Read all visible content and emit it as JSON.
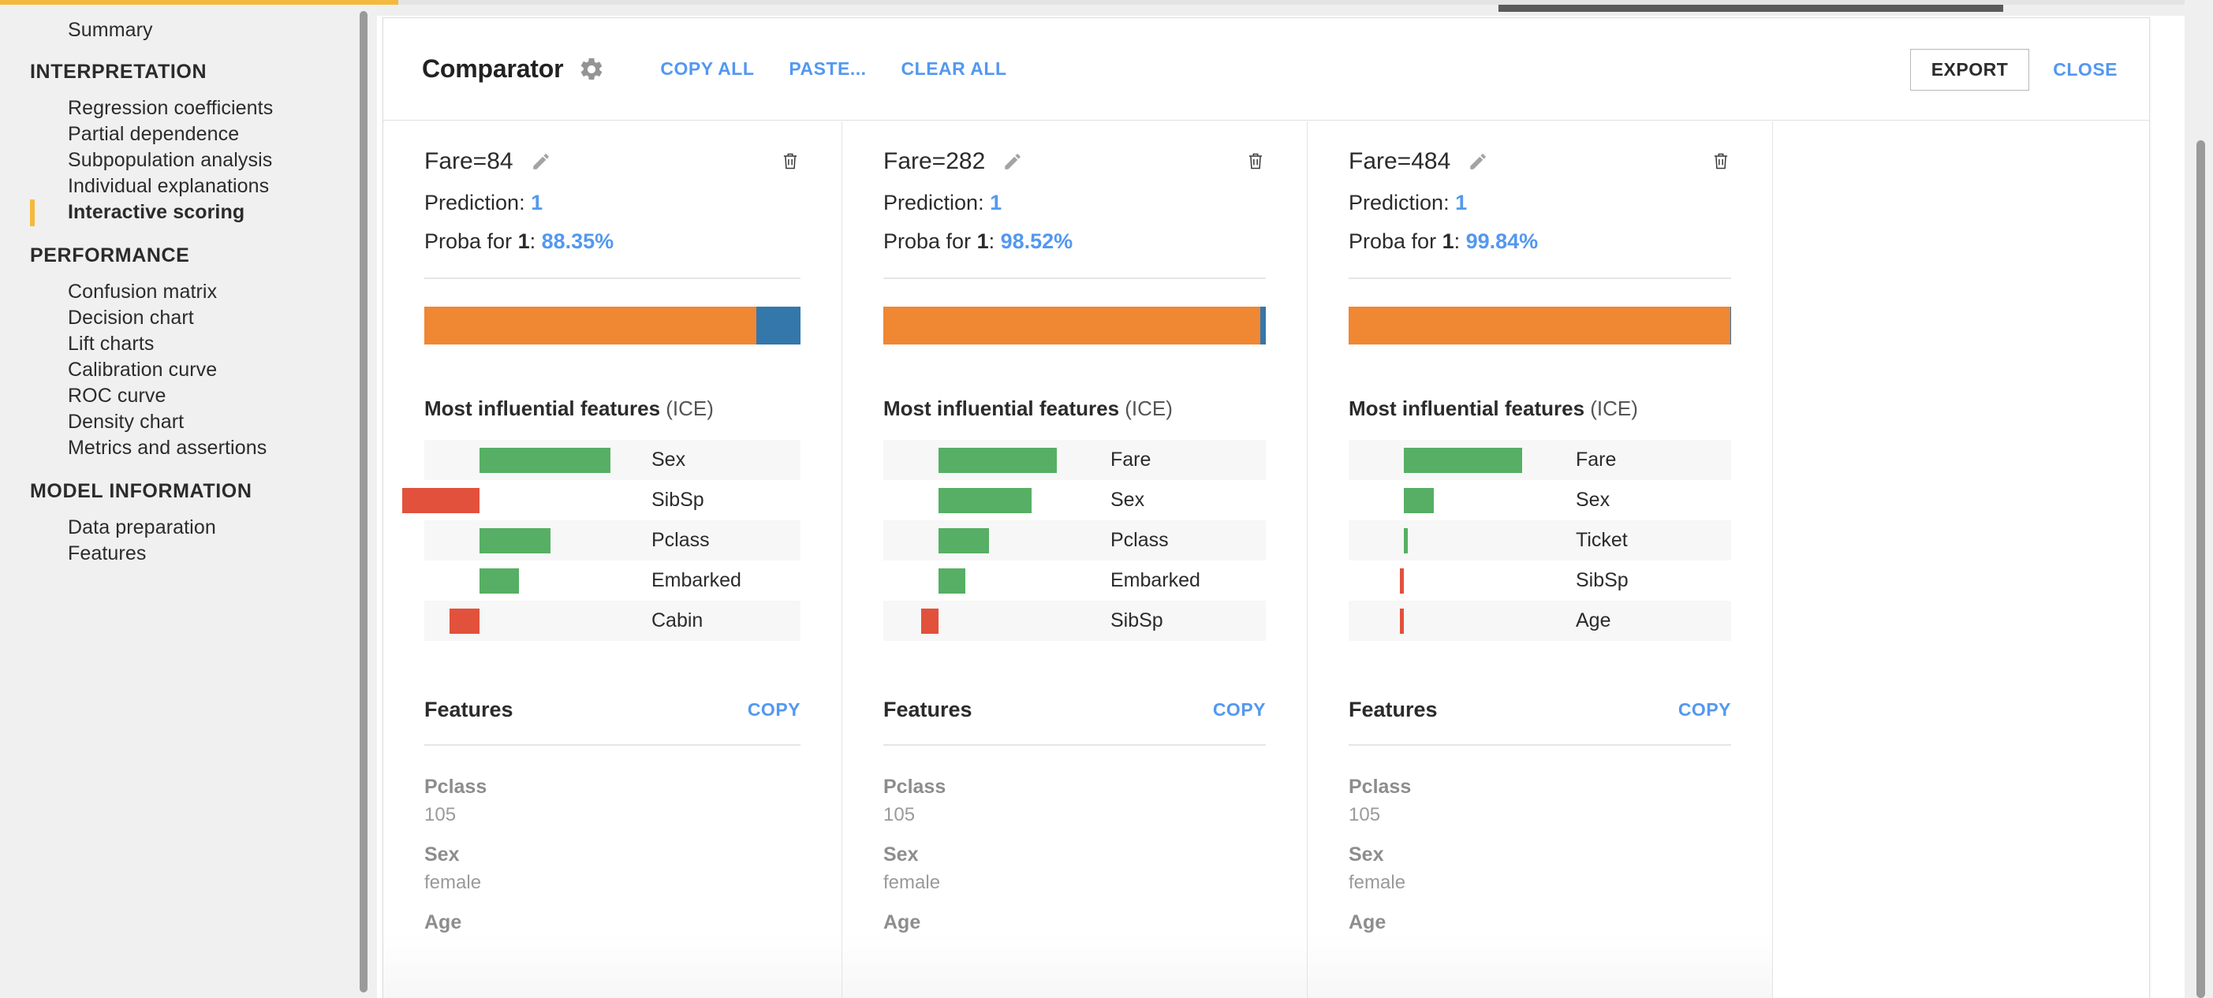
{
  "accent": {
    "link": "#5398f0",
    "highlight": "#f4b93e",
    "positive": "#56af64",
    "negative": "#e2513c",
    "orange": "#ef8733",
    "blue": "#3477ab"
  },
  "sidebar": {
    "top_item": {
      "label": "Summary"
    },
    "sections": [
      {
        "heading": "INTERPRETATION",
        "items": [
          {
            "label": "Regression coefficients",
            "active": false
          },
          {
            "label": "Partial dependence",
            "active": false
          },
          {
            "label": "Subpopulation analysis",
            "active": false
          },
          {
            "label": "Individual explanations",
            "active": false
          },
          {
            "label": "Interactive scoring",
            "active": true
          }
        ]
      },
      {
        "heading": "PERFORMANCE",
        "items": [
          {
            "label": "Confusion matrix",
            "active": false
          },
          {
            "label": "Decision chart",
            "active": false
          },
          {
            "label": "Lift charts",
            "active": false
          },
          {
            "label": "Calibration curve",
            "active": false
          },
          {
            "label": "ROC curve",
            "active": false
          },
          {
            "label": "Density chart",
            "active": false
          },
          {
            "label": "Metrics and assertions",
            "active": false
          }
        ]
      },
      {
        "heading": "MODEL INFORMATION",
        "items": [
          {
            "label": "Data preparation",
            "active": false
          },
          {
            "label": "Features",
            "active": false
          }
        ]
      }
    ]
  },
  "header": {
    "title": "Comparator",
    "gear_icon": "gear-icon",
    "links": [
      {
        "label": "COPY ALL",
        "name": "copy-all"
      },
      {
        "label": "PASTE...",
        "name": "paste"
      },
      {
        "label": "CLEAR ALL",
        "name": "clear-all"
      }
    ],
    "export_label": "EXPORT",
    "close_label": "CLOSE"
  },
  "labels": {
    "prediction_prefix": "Prediction: ",
    "proba_prefix": "Proba for ",
    "proba_mid": ": ",
    "ice_title_strong": "Most influential features ",
    "ice_title_light": "(ICE)",
    "features_title": "Features",
    "copy_label": "COPY",
    "edit_icon": "pencil-icon",
    "delete_icon": "trash-icon"
  },
  "columns": [
    {
      "name": "Fare=84",
      "prediction": "1",
      "proba_class": "1",
      "proba_value": "88.35%",
      "proba_pct": 88.35,
      "ice": [
        {
          "feature": "Sex",
          "value": 0.415,
          "sign": "pos"
        },
        {
          "feature": "SibSp",
          "value": -0.245,
          "sign": "neg"
        },
        {
          "feature": "Pclass",
          "value": 0.225,
          "sign": "pos"
        },
        {
          "feature": "Embarked",
          "value": 0.125,
          "sign": "pos"
        },
        {
          "feature": "Cabin",
          "value": -0.095,
          "sign": "neg"
        }
      ],
      "features": [
        {
          "key": "Pclass",
          "value": "105"
        },
        {
          "key": "Sex",
          "value": "female"
        },
        {
          "key": "Age",
          "value": ""
        }
      ]
    },
    {
      "name": "Fare=282",
      "prediction": "1",
      "proba_class": "1",
      "proba_value": "98.52%",
      "proba_pct": 98.52,
      "ice": [
        {
          "feature": "Fare",
          "value": 0.375,
          "sign": "pos"
        },
        {
          "feature": "Sex",
          "value": 0.295,
          "sign": "pos"
        },
        {
          "feature": "Pclass",
          "value": 0.16,
          "sign": "pos"
        },
        {
          "feature": "Embarked",
          "value": 0.085,
          "sign": "pos"
        },
        {
          "feature": "SibSp",
          "value": -0.055,
          "sign": "neg"
        }
      ],
      "features": [
        {
          "key": "Pclass",
          "value": "105"
        },
        {
          "key": "Sex",
          "value": "female"
        },
        {
          "key": "Age",
          "value": ""
        }
      ]
    },
    {
      "name": "Fare=484",
      "prediction": "1",
      "proba_class": "1",
      "proba_value": "99.84%",
      "proba_pct": 99.84,
      "ice": [
        {
          "feature": "Fare",
          "value": 0.375,
          "sign": "pos"
        },
        {
          "feature": "Sex",
          "value": 0.095,
          "sign": "pos"
        },
        {
          "feature": "Ticket",
          "value": 0.012,
          "sign": "pos"
        },
        {
          "feature": "SibSp",
          "value": -0.012,
          "sign": "neg"
        },
        {
          "feature": "Age",
          "value": -0.012,
          "sign": "neg"
        }
      ],
      "features": [
        {
          "key": "Pclass",
          "value": "105"
        },
        {
          "key": "Sex",
          "value": "female"
        },
        {
          "key": "Age",
          "value": ""
        }
      ]
    }
  ],
  "chart_data": [
    {
      "type": "bar",
      "title": "Most influential features (ICE) — Fare=84",
      "orientation": "horizontal",
      "categories": [
        "Sex",
        "SibSp",
        "Pclass",
        "Embarked",
        "Cabin"
      ],
      "values": [
        0.415,
        -0.245,
        0.225,
        0.125,
        -0.095
      ],
      "xlabel": "",
      "ylabel": "",
      "xlim": [
        -0.45,
        0.55
      ],
      "grid": false,
      "legend": null
    },
    {
      "type": "bar",
      "title": "Most influential features (ICE) — Fare=282",
      "orientation": "horizontal",
      "categories": [
        "Fare",
        "Sex",
        "Pclass",
        "Embarked",
        "SibSp"
      ],
      "values": [
        0.375,
        0.295,
        0.16,
        0.085,
        -0.055
      ],
      "xlabel": "",
      "ylabel": "",
      "xlim": [
        -0.45,
        0.55
      ],
      "grid": false,
      "legend": null
    },
    {
      "type": "bar",
      "title": "Most influential features (ICE) — Fare=484",
      "orientation": "horizontal",
      "categories": [
        "Fare",
        "Sex",
        "Ticket",
        "SibSp",
        "Age"
      ],
      "values": [
        0.375,
        0.095,
        0.012,
        -0.012,
        -0.012
      ],
      "xlabel": "",
      "ylabel": "",
      "xlim": [
        -0.45,
        0.55
      ],
      "grid": false,
      "legend": null
    }
  ]
}
